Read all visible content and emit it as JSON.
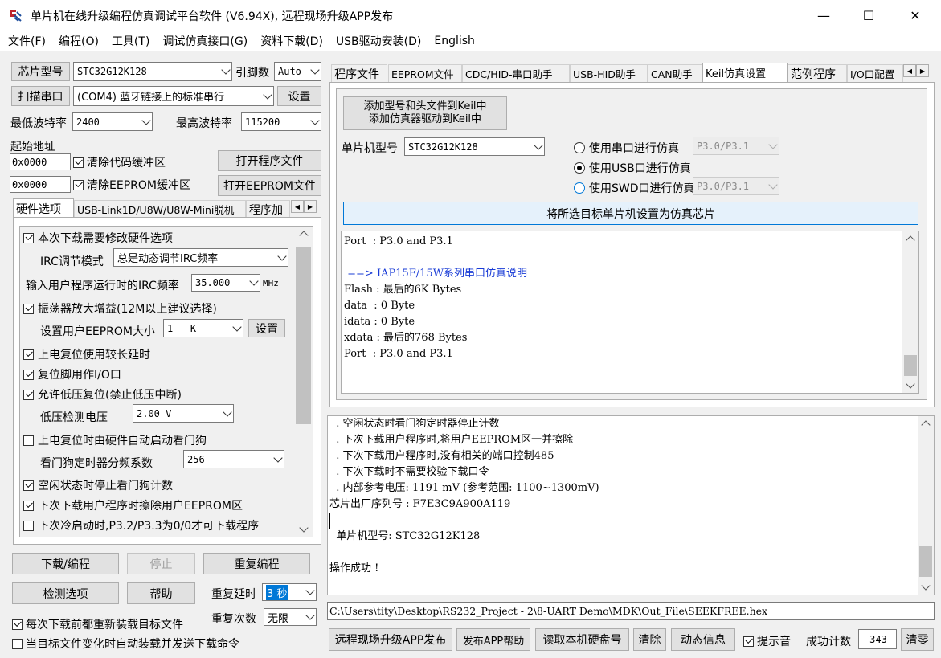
{
  "window": {
    "title": "单片机在线升级编程仿真调试平台软件 (V6.94X), 远程现场升级APP发布",
    "minimize": "—",
    "maximize": "☐",
    "close": "✕"
  },
  "menu": [
    "文件(F)",
    "编程(O)",
    "工具(T)",
    "调试仿真接口(G)",
    "资料下载(D)",
    "USB驱动安装(D)",
    "English"
  ],
  "left": {
    "chip_type_btn": "芯片型号",
    "chip_type": "STC32G12K128",
    "pin_label": "引脚数",
    "pin_value": "Auto",
    "scan_btn": "扫描串口",
    "com_port": "(COM4) 蓝牙链接上的标准串行",
    "settings_btn": "设置",
    "min_baud_label": "最低波特率",
    "min_baud": "2400",
    "max_baud_label": "最高波特率",
    "max_baud": "115200",
    "start_addr_label": "起始地址",
    "addr1": "0x0000",
    "clear_code": "清除代码缓冲区",
    "open_prog_btn": "打开程序文件",
    "addr2": "0x0000",
    "clear_eeprom": "清除EEPROM缓冲区",
    "open_eeprom_btn": "打开EEPROM文件",
    "tabs": [
      "硬件选项",
      "USB-Link1D/U8W/U8W-Mini脱机",
      "程序加"
    ],
    "hw": {
      "modify_hw": "本次下载需要修改硬件选项",
      "irc_mode_label": "IRC调节模式",
      "irc_mode": "总是动态调节IRC频率",
      "irc_freq_label": "输入用户程序运行时的IRC频率",
      "irc_freq": "35.000",
      "mhz": "MHz",
      "osc_gain": "振荡器放大增益(12M以上建议选择)",
      "eeprom_size_label": "设置用户EEPROM大小",
      "eeprom_size": "1   K",
      "eeprom_set_btn": "设置",
      "power_delay": "上电复位使用较长延时",
      "reset_io": "复位脚用作I/O口",
      "low_volt_reset": "允许低压复位(禁止低压中断)",
      "low_volt_label": "低压检测电压",
      "low_volt": "2.00 V",
      "auto_wdt": "上电复位时由硬件自动启动看门狗",
      "wdt_div_label": "看门狗定时器分频系数",
      "wdt_div": "256",
      "idle_wdt": "空闲状态时停止看门狗计数",
      "erase_eeprom": "下次下载用户程序时擦除用户EEPROM区",
      "cold_boot": "下次冷启动时,P3.2/P3.3为0/0才可下载程序"
    },
    "download_btn": "下载/编程",
    "stop_btn": "停止",
    "reprogram_btn": "重复编程",
    "check_btn": "检测选项",
    "help_btn": "帮助",
    "repeat_delay_label": "重复延时",
    "repeat_delay": "3 秒",
    "repeat_count_label": "重复次数",
    "repeat_count": "无限",
    "reload_each": "每次下载前都重新装载目标文件",
    "auto_send": "当目标文件变化时自动装载并发送下载命令"
  },
  "right": {
    "tabs": [
      "程序文件",
      "EEPROM文件",
      "CDC/HID-串口助手",
      "USB-HID助手",
      "CAN助手",
      "Keil仿真设置",
      "范例程序",
      "I/O口配置"
    ],
    "keil": {
      "add_btn_line1": "添加型号和头文件到Keil中",
      "add_btn_line2": "添加仿真器驱动到Keil中",
      "mcu_label": "单片机型号",
      "mcu": "STC32G12K128",
      "use_serial": "使用串口进行仿真",
      "serial_port": "P3.0/P3.1",
      "use_usb": "使用USB口进行仿真",
      "use_swd": "使用SWD口进行仿真",
      "swd_port": "P3.0/P3.1",
      "set_chip_btn": "将所选目标单片机设置为仿真芯片",
      "info": [
        "Port  : P3.0 and P3.1",
        "",
        " ==> IAP15F/15W系列串口仿真说明",
        "Flash : 最后的6K Bytes",
        "data  : 0 Byte",
        "idata : 0 Byte",
        "xdata : 最后的768 Bytes",
        "Port  : P3.0 and P3.1"
      ]
    },
    "log": [
      "  . 空闲状态时看门狗定时器停止计数",
      "  . 下次下载用户程序时,将用户EEPROM区一并擦除",
      "  . 下次下载用户程序时,没有相关的端口控制485",
      "  . 下次下载时不需要校验下载口令",
      "  . 内部参考电压: 1191 mV (参考范围: 1100~1300mV)",
      "芯片出厂序列号 : F7E3C9A900A119",
      "",
      "  单片机型号: STC32G12K128",
      "",
      "操作成功 !"
    ],
    "file_path": "C:\\Users\\tity\\Desktop\\RS232_Project - 2\\8-UART Demo\\MDK\\Out_File\\SEEKFREE.hex",
    "remote_btn": "远程现场升级APP发布",
    "app_help_btn": "发布APP帮助",
    "read_disk_btn": "读取本机硬盘号",
    "clear_btn": "清除",
    "dynamic_btn": "动态信息",
    "beep": "提示音",
    "success_label": "成功计数",
    "success_count": "343",
    "reset_btn": "清零"
  }
}
